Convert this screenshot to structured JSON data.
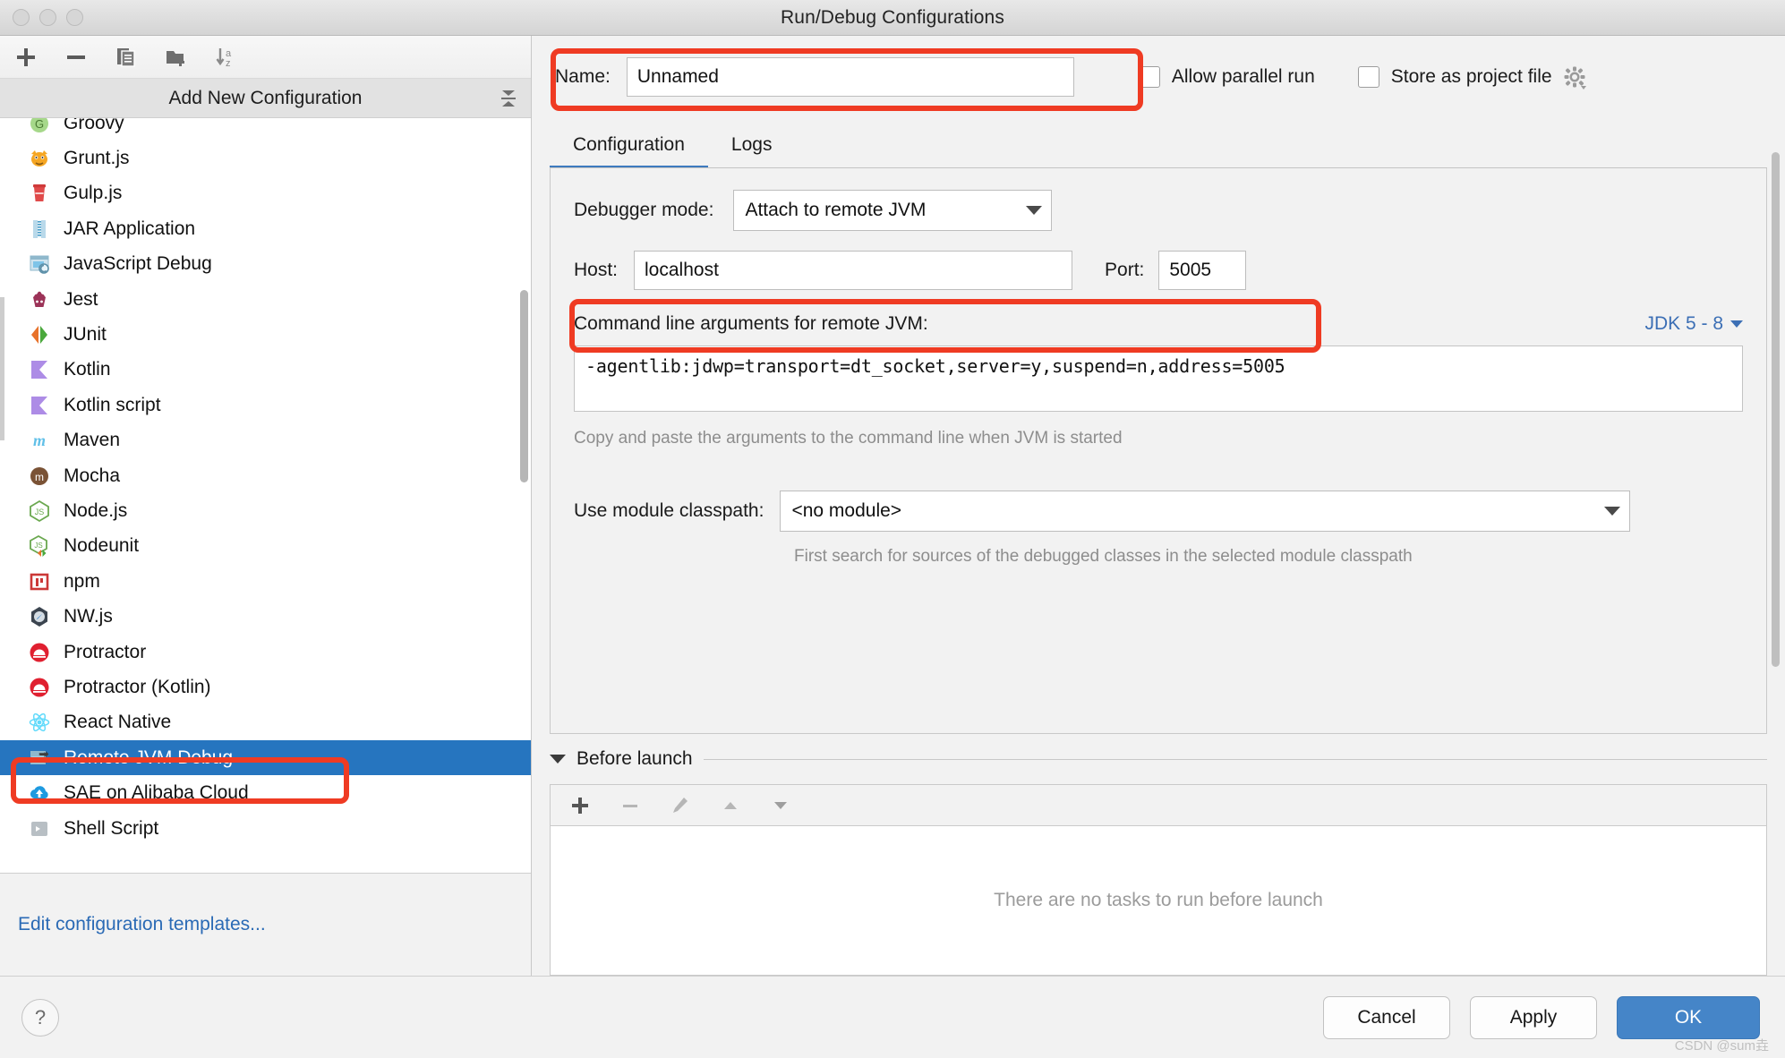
{
  "window": {
    "title": "Run/Debug Configurations"
  },
  "left_toolbar": {
    "add_label": "+",
    "remove_label": "−",
    "copy_icon": "copy-icon",
    "save_folder_icon": "move-to-folder-icon",
    "sort_icon": "sort-alphabetically-icon"
  },
  "sidebar": {
    "header": "Add New Configuration",
    "footer_link": "Edit configuration templates...",
    "items": [
      {
        "label": "Groovy",
        "icon": "groovy-icon",
        "selected": false
      },
      {
        "label": "Grunt.js",
        "icon": "grunt-icon",
        "selected": false
      },
      {
        "label": "Gulp.js",
        "icon": "gulp-icon",
        "selected": false
      },
      {
        "label": "JAR Application",
        "icon": "jar-icon",
        "selected": false
      },
      {
        "label": "JavaScript Debug",
        "icon": "javascript-debug-icon",
        "selected": false
      },
      {
        "label": "Jest",
        "icon": "jest-icon",
        "selected": false
      },
      {
        "label": "JUnit",
        "icon": "junit-icon",
        "selected": false
      },
      {
        "label": "Kotlin",
        "icon": "kotlin-icon",
        "selected": false
      },
      {
        "label": "Kotlin script",
        "icon": "kotlin-script-icon",
        "selected": false
      },
      {
        "label": "Maven",
        "icon": "maven-icon",
        "selected": false
      },
      {
        "label": "Mocha",
        "icon": "mocha-icon",
        "selected": false
      },
      {
        "label": "Node.js",
        "icon": "nodejs-icon",
        "selected": false
      },
      {
        "label": "Nodeunit",
        "icon": "nodeunit-icon",
        "selected": false
      },
      {
        "label": "npm",
        "icon": "npm-icon",
        "selected": false
      },
      {
        "label": "NW.js",
        "icon": "nwjs-icon",
        "selected": false
      },
      {
        "label": "Protractor",
        "icon": "protractor-icon",
        "selected": false
      },
      {
        "label": "Protractor (Kotlin)",
        "icon": "protractor-kotlin-icon",
        "selected": false
      },
      {
        "label": "React Native",
        "icon": "react-native-icon",
        "selected": false
      },
      {
        "label": "Remote JVM Debug",
        "icon": "remote-jvm-debug-icon",
        "selected": true
      },
      {
        "label": "SAE on Alibaba Cloud",
        "icon": "alibaba-cloud-icon",
        "selected": false
      },
      {
        "label": "Shell Script",
        "icon": "shell-script-icon",
        "selected": false
      }
    ]
  },
  "form": {
    "name_label": "Name:",
    "name_value": "Unnamed",
    "allow_parallel_run": "Allow parallel run",
    "store_as_project_file": "Store as project file",
    "gear_icon": "gear-icon"
  },
  "tabs": [
    {
      "label": "Configuration",
      "active": true
    },
    {
      "label": "Logs",
      "active": false
    }
  ],
  "configuration": {
    "debugger_mode_label": "Debugger mode:",
    "debugger_mode_value": "Attach to remote JVM",
    "host_label": "Host:",
    "host_value": "localhost",
    "port_label": "Port:",
    "port_value": "5005",
    "args_label": "Command line arguments for remote JVM:",
    "jdk_selector": "JDK 5 - 8",
    "args_value": "-agentlib:jdwp=transport=dt_socket,server=y,suspend=n,address=5005",
    "args_hint": "Copy and paste the arguments to the command line when JVM is started",
    "module_label": "Use module classpath:",
    "module_value": "<no module>",
    "module_hint": "First search for sources of the debugged classes in the selected module classpath"
  },
  "before_launch": {
    "title": "Before launch",
    "empty_text": "There are no tasks to run before launch",
    "toolbar": {
      "add": "+",
      "remove": "−",
      "edit_icon": "pencil-icon",
      "up_icon": "arrow-up-icon",
      "down_icon": "arrow-down-icon"
    }
  },
  "footer": {
    "help_label": "?",
    "cancel_label": "Cancel",
    "apply_label": "Apply",
    "ok_label": "OK",
    "watermark": "CSDN @sum垚"
  },
  "colors": {
    "accent": "#2675bf",
    "primary_button": "#4585c8",
    "annotation": "#ef3b23",
    "link": "#2a6ab5"
  }
}
